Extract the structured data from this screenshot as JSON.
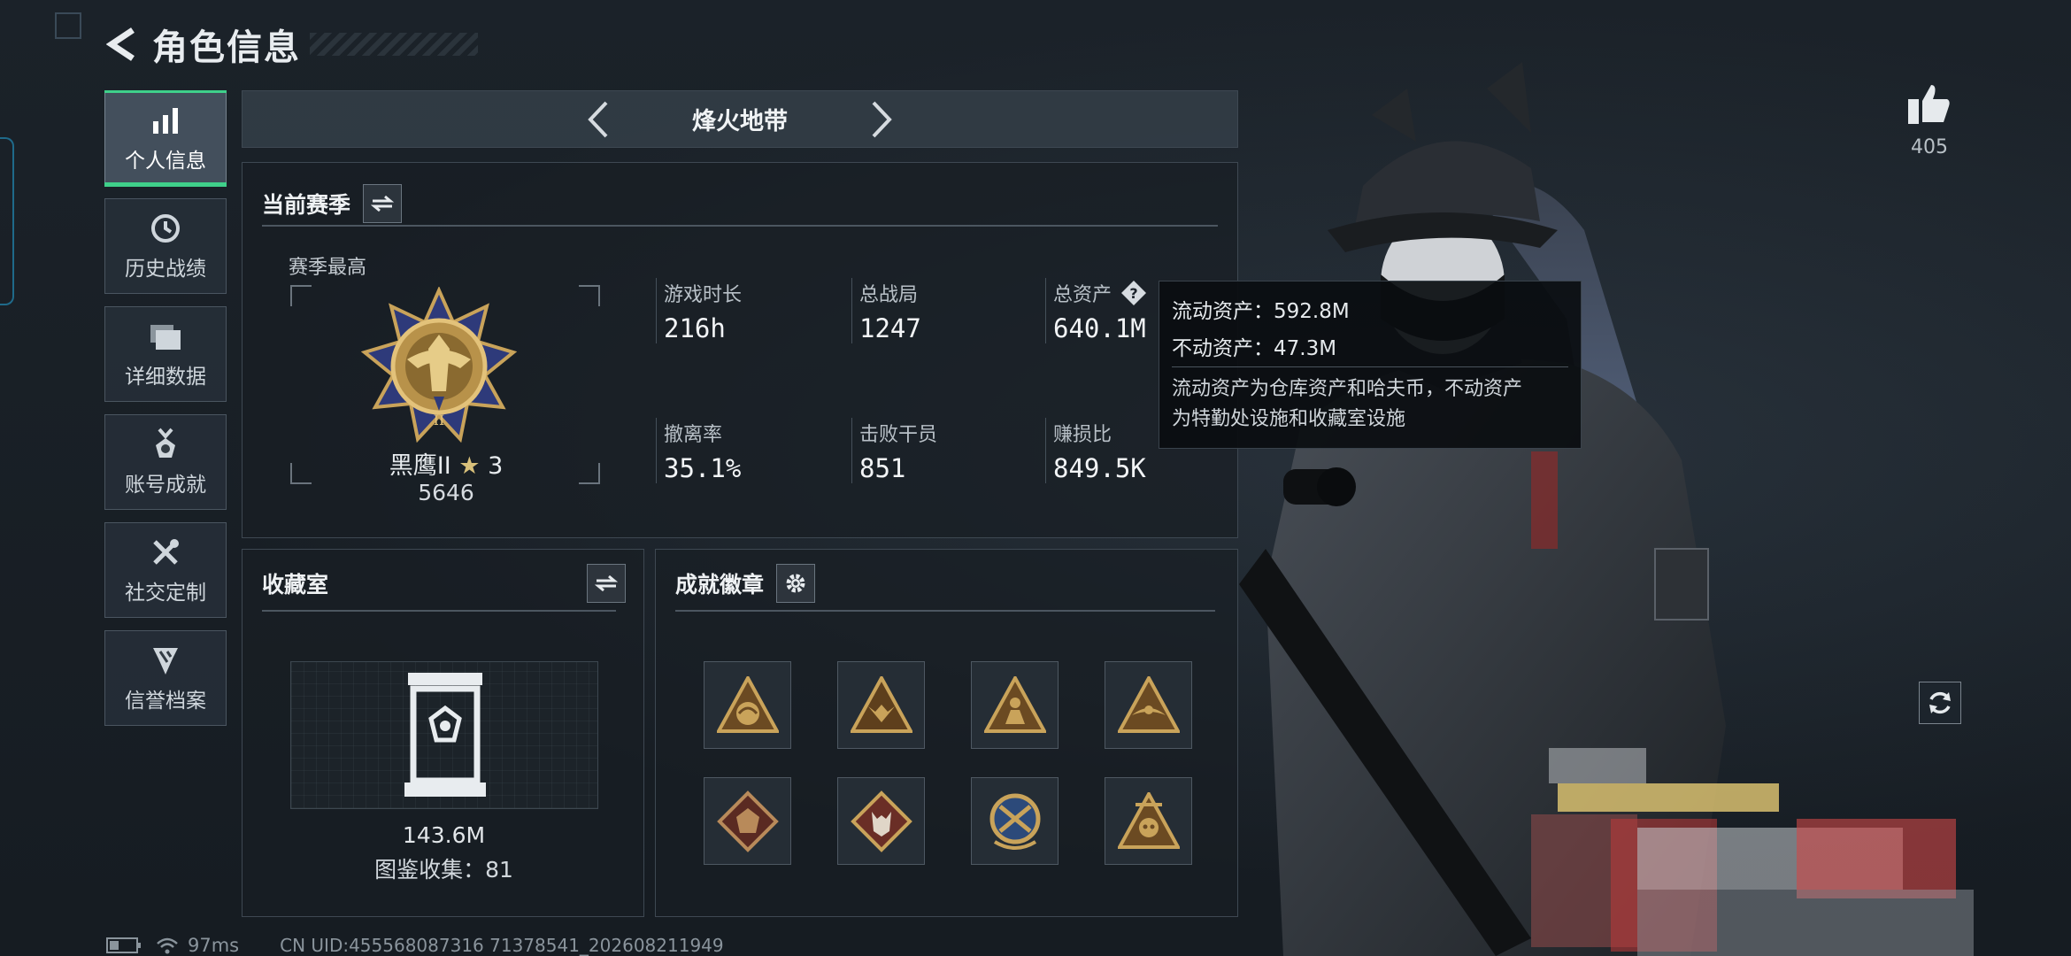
{
  "header": {
    "title": "角色信息"
  },
  "sidebar": {
    "items": [
      {
        "label": "个人信息",
        "icon": "bar-chart-icon",
        "active": true
      },
      {
        "label": "历史战绩",
        "icon": "history-clock-icon",
        "active": false
      },
      {
        "label": "详细数据",
        "icon": "folder-icon",
        "active": false
      },
      {
        "label": "账号成就",
        "icon": "achievement-medal-icon",
        "active": false
      },
      {
        "label": "社交定制",
        "icon": "tools-icon",
        "active": false
      },
      {
        "label": "信誉档案",
        "icon": "credit-shield-icon",
        "active": false
      }
    ]
  },
  "map_selector": {
    "name": "烽火地带"
  },
  "season": {
    "title": "当前赛季",
    "best_label": "赛季最高",
    "rank_name": "黑鹰II",
    "rank_stars": "3",
    "rank_score": "5646",
    "stats": [
      {
        "label": "游戏时长",
        "value": "216h"
      },
      {
        "label": "总战局",
        "value": "1247"
      },
      {
        "label": "总资产",
        "value": "640.1M"
      },
      {
        "label": "撤离率",
        "value": "35.1%"
      },
      {
        "label": "击败干员",
        "value": "851"
      },
      {
        "label": "赚损比",
        "value": "849.5K"
      }
    ]
  },
  "tooltip": {
    "liquid": "流动资产：592.8M",
    "fixed": "不动资产：47.3M",
    "desc_line1": "流动资产为仓库资产和哈夫币，不动资产",
    "desc_line2": "为特勤处设施和收藏室设施"
  },
  "collection": {
    "title": "收藏室",
    "value": "143.6M",
    "count": "图鉴收集：81"
  },
  "badges": {
    "title": "成就徽章",
    "items": [
      "dragon-badge-icon",
      "bull-badge-icon",
      "soldier-badge-icon",
      "wings-badge-icon",
      "dragon-head-badge-icon",
      "wolf-badge-icon",
      "crossed-guns-badge-icon",
      "skull-badge-icon"
    ]
  },
  "like": {
    "count": "405"
  },
  "status_bar": {
    "ping": "97ms",
    "uid": "CN UID:455568087316 71378541_202608211949"
  },
  "colors": {
    "accent": "#3fd08a",
    "gold": "#c9a35a",
    "background": "#1a2129"
  }
}
